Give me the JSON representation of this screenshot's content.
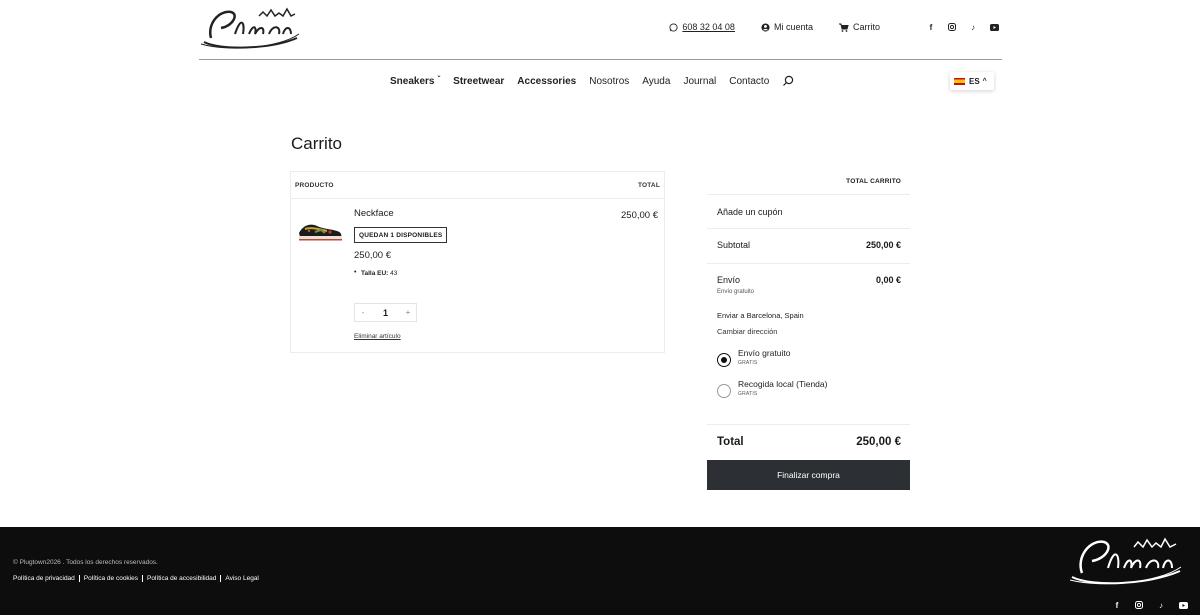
{
  "brand": {
    "name": "Plugtown"
  },
  "header": {
    "phone": "608 32 04 08",
    "account": "Mi cuenta",
    "cart": "Carrito",
    "socials": [
      "facebook-icon",
      "instagram-icon",
      "tiktok-icon",
      "youtube-icon"
    ]
  },
  "nav": {
    "items": [
      {
        "label": "Sneakers",
        "bold": true,
        "dropdown": true
      },
      {
        "label": "Streetwear",
        "bold": true
      },
      {
        "label": "Accessories",
        "bold": true
      },
      {
        "label": "Nosotros"
      },
      {
        "label": "Ayuda"
      },
      {
        "label": "Journal"
      },
      {
        "label": "Contacto"
      }
    ],
    "language": "ES"
  },
  "page": {
    "title": "Carrito"
  },
  "cart": {
    "col_product": "PRODUCTO",
    "col_total": "TOTAL",
    "item": {
      "name": "Neckface",
      "stock_badge": "QUEDAN 1 DISPONIBLES",
      "price": "250,00 €",
      "size_label": "Talla EU:",
      "size_value": "43",
      "quantity": "1",
      "qty_minus": "-",
      "qty_plus": "+",
      "remove": "Eliminar artículo",
      "line_total": "250,00 €"
    }
  },
  "totals": {
    "heading": "TOTAL CARRITO",
    "coupon": "Añade un cupón",
    "subtotal_label": "Subtotal",
    "subtotal_value": "250,00 €",
    "shipping_label": "Envío",
    "shipping_value": "0,00 €",
    "shipping_sub": "Envío gratuito",
    "ship_to": "Enviar a Barcelona, Spain",
    "change_address": "Cambiar dirección",
    "options": [
      {
        "label": "Envío gratuito",
        "sub": "GRATIS",
        "selected": true
      },
      {
        "label": "Recogida local (Tienda)",
        "sub": "GRATIS",
        "selected": false
      }
    ],
    "total_label": "Total",
    "total_value": "250,00 €",
    "checkout": "Finalizar compra"
  },
  "footer": {
    "copyright": "© Plugtown2026 . Todos los derechos reservados.",
    "links": [
      "Política de privacidad",
      "Política de cookies",
      "Política de accesibilidad",
      "Aviso Legal"
    ]
  }
}
